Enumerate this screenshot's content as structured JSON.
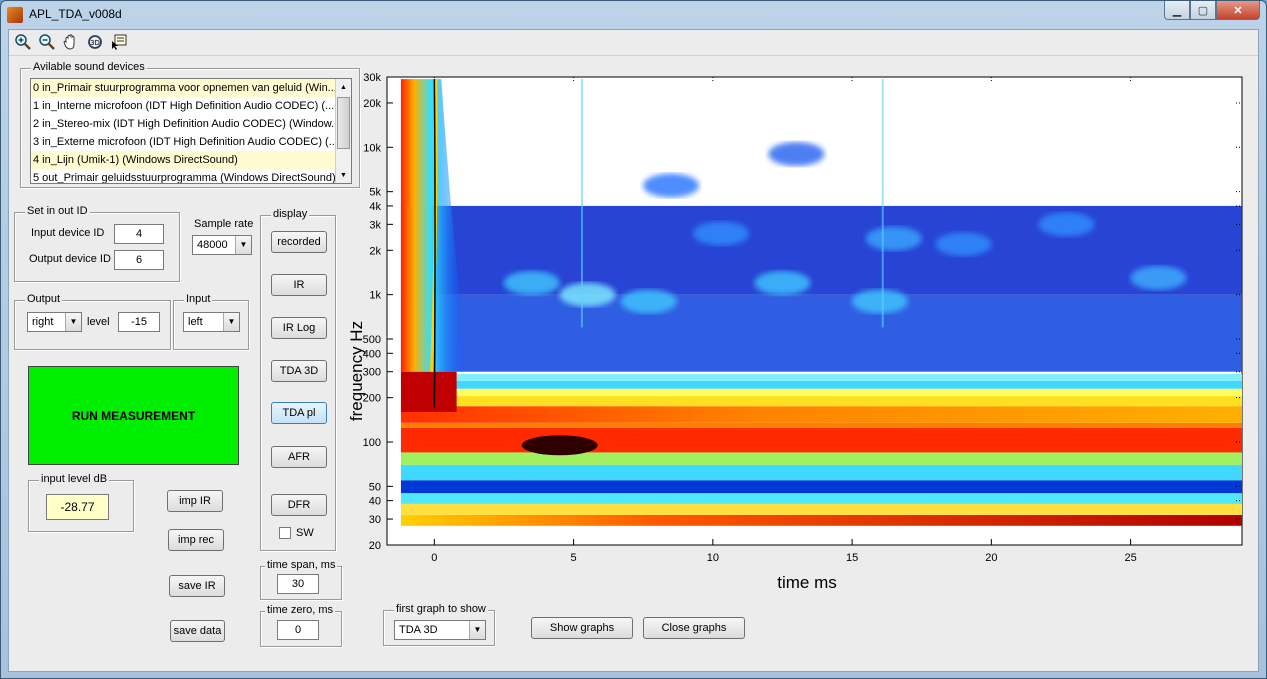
{
  "window": {
    "title": "APL_TDA_v008d"
  },
  "toolbar": {
    "icons": [
      "zoom-in-icon",
      "zoom-out-icon",
      "pan-hand-icon",
      "rotate-3d-icon",
      "data-cursor-icon"
    ]
  },
  "devices": {
    "title": "Avilable sound devices",
    "items": [
      "0 in_Primair stuurprogramma voor opnemen van geluid (Win...",
      "1 in_Interne microfoon (IDT High Definition Audio CODEC) (...",
      "2 in_Stereo-mix (IDT High Definition Audio CODEC) (Window...",
      "3 in_Externe microfoon (IDT High Definition Audio CODEC) (...",
      "4 in_Lijn (Umik-1) (Windows DirectSound)",
      "5 out_Primair geluidsstuurprogramma (Windows DirectSound)"
    ]
  },
  "io": {
    "title": "Set in out ID",
    "input_label": "Input device ID",
    "input_value": "4",
    "output_label": "Output device ID",
    "output_value": "6"
  },
  "sample_rate": {
    "label": "Sample rate",
    "value": "48000"
  },
  "output": {
    "title": "Output",
    "channel": "right",
    "level_label": "level",
    "level_value": "-15"
  },
  "input": {
    "title": "Input",
    "channel": "left"
  },
  "run": {
    "label": "RUN MEASUREMENT"
  },
  "input_level": {
    "title": "input level dB",
    "value": "-28.77"
  },
  "actions": {
    "imp_ir": "imp IR",
    "imp_rec": "imp rec",
    "save_ir": "save IR",
    "save_data": "save data"
  },
  "display": {
    "title": "display",
    "buttons": [
      "recorded",
      "IR",
      "IR Log",
      "TDA 3D",
      "TDA pl",
      "AFR",
      "DFR"
    ],
    "sw_label": "SW"
  },
  "time_span": {
    "title": "time span, ms",
    "value": "30"
  },
  "time_zero": {
    "title": "time zero, ms",
    "value": "0"
  },
  "first_graph": {
    "title": "first graph to show",
    "value": "TDA 3D"
  },
  "graph_buttons": {
    "show": "Show graphs",
    "close": "Close graphs"
  },
  "plot": {
    "ylabel": "frequency   Hz",
    "xlabel": "time   ms",
    "yticks": [
      "20",
      "30",
      "40",
      "50",
      "100",
      "200",
      "300",
      "400",
      "500",
      "1k",
      "2k",
      "3k",
      "4k",
      "5k",
      "10k",
      "20k",
      "30k"
    ],
    "xticks": [
      "0",
      "5",
      "10",
      "15",
      "20",
      "25"
    ]
  },
  "chart_data": {
    "type": "heatmap",
    "title": "",
    "xlabel": "time   ms",
    "ylabel": "frequency   Hz",
    "xlim": [
      -1.7,
      29
    ],
    "ylim": [
      20,
      30000
    ],
    "yscale": "log",
    "colormap": "jet",
    "x_ticks": [
      0,
      5,
      10,
      15,
      20,
      25
    ],
    "y_ticks": [
      20,
      30,
      40,
      50,
      100,
      200,
      300,
      400,
      500,
      1000,
      2000,
      3000,
      4000,
      5000,
      10000,
      20000,
      30000
    ]
  }
}
